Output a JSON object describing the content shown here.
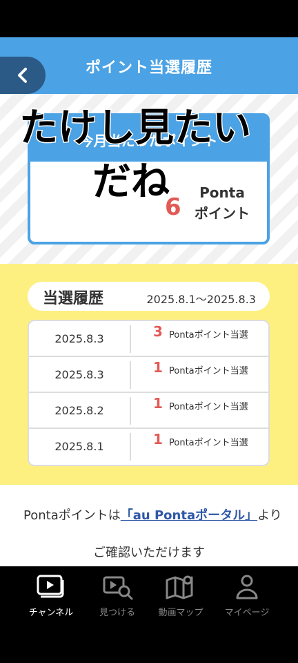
{
  "header": {
    "title": "ポイント当選履歴"
  },
  "month_card": {
    "heading": "今月当たったポイント",
    "points": "6",
    "unit_line1": "Ponta",
    "unit_line2": "ポイント"
  },
  "overlay": {
    "line1": "たけし見たい",
    "line2": "だね"
  },
  "history": {
    "title": "当選履歴",
    "range": "2025.8.1～2025.8.3",
    "rows": [
      {
        "date": "2025.8.3",
        "points": "3",
        "label": "Pontaポイント当選"
      },
      {
        "date": "2025.8.3",
        "points": "1",
        "label": "Pontaポイント当選"
      },
      {
        "date": "2025.8.2",
        "points": "1",
        "label": "Pontaポイント当選"
      },
      {
        "date": "2025.8.1",
        "points": "1",
        "label": "Pontaポイント当選"
      }
    ]
  },
  "note": {
    "prefix": "Pontaポイントは",
    "link": "「au Pontaポータル」",
    "suffix": "より",
    "line2": "ご確認いただけます"
  },
  "nav": [
    {
      "label": "チャンネル",
      "icon": "play-icon"
    },
    {
      "label": "見つける",
      "icon": "search-video-icon"
    },
    {
      "label": "動画マップ",
      "icon": "map-icon"
    },
    {
      "label": "マイページ",
      "icon": "person-icon"
    }
  ],
  "colors": {
    "header": "#4ba2e4",
    "accent_red": "#e25a55",
    "yellow": "#fdf081",
    "link": "#2f59a8"
  }
}
